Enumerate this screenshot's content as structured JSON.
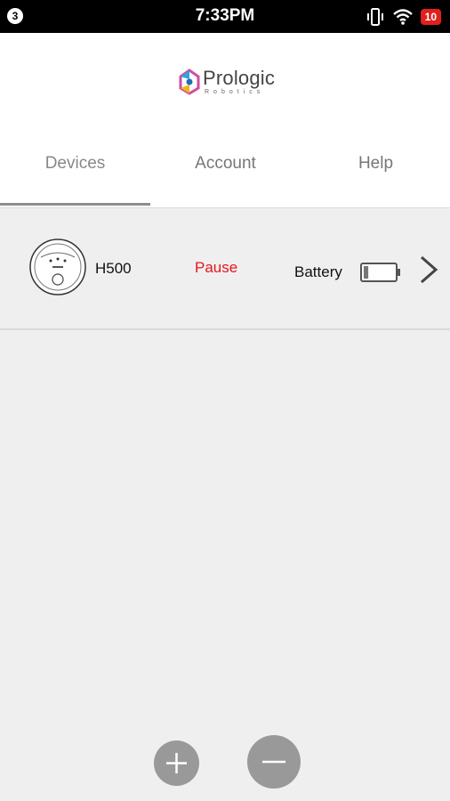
{
  "status_bar": {
    "notification_count": "3",
    "time": "7:33PM",
    "battery_level": "10"
  },
  "brand": {
    "name": "Prologic",
    "tagline": "Robotics"
  },
  "tabs": [
    {
      "label": "Devices",
      "active": true
    },
    {
      "label": "Account",
      "active": false
    },
    {
      "label": "Help",
      "active": false
    }
  ],
  "devices": [
    {
      "name": "H500",
      "status": "Pause",
      "battery_label": "Battery",
      "battery_level": 0.15
    }
  ],
  "actions": {
    "add_icon": "plus-icon",
    "remove_icon": "minus-icon"
  },
  "colors": {
    "status_paused": "#e6161b",
    "status_bar_badge": "#e0201e",
    "fab": "#999999"
  }
}
